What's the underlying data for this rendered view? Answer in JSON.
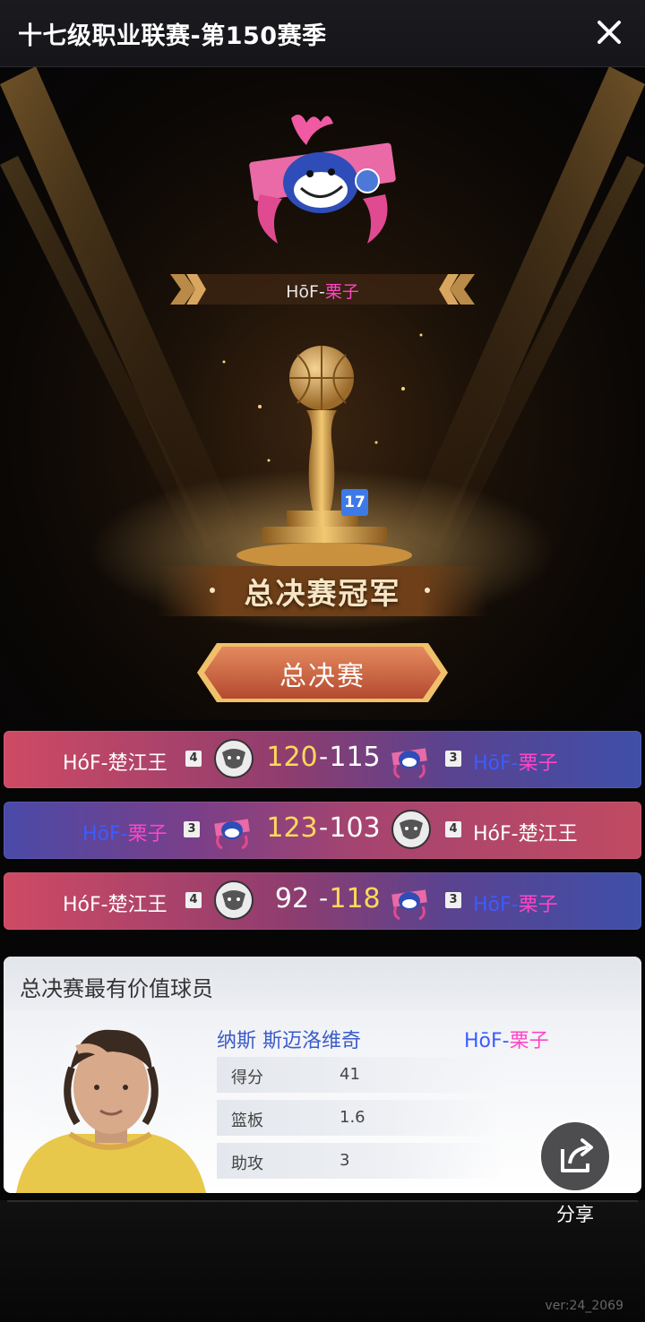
{
  "header": {
    "title": "十七级职业联赛-第150赛季",
    "close_icon": "close-icon"
  },
  "champion": {
    "team_prefix": "HōF-",
    "team_name": "栗子",
    "trophy_level": "17",
    "banner": "总决赛冠军"
  },
  "finals_label": "总决赛",
  "games": [
    {
      "left_team": "HóF-楚江王",
      "left_seed": "4",
      "left_score": "120",
      "right_score": "115",
      "right_seed": "3",
      "right_prefix": "HōF-",
      "right_name": "栗子"
    },
    {
      "left_prefix": "HōF-",
      "left_name": "栗子",
      "left_seed": "3",
      "left_score": "123",
      "right_score": "103",
      "right_seed": "4",
      "right_team": "HóF-楚江王"
    },
    {
      "left_team": "HóF-楚江王",
      "left_seed": "4",
      "left_score": "92",
      "right_score": "118",
      "right_seed": "3",
      "right_prefix": "HōF-",
      "right_name": "栗子"
    }
  ],
  "mvp": {
    "title": "总决赛最有价值球员",
    "player_name": "纳斯 斯迈洛维奇",
    "team_prefix": "HōF-",
    "team_name": "栗子",
    "stats": [
      {
        "label": "得分",
        "value": "41"
      },
      {
        "label": "篮板",
        "value": "1.6"
      },
      {
        "label": "助攻",
        "value": "3"
      }
    ]
  },
  "share_label": "分享",
  "version": "ver:24_2069",
  "colors": {
    "pink": "#ff45c7",
    "blue": "#3b5cff",
    "gold": "#ffd95a"
  }
}
